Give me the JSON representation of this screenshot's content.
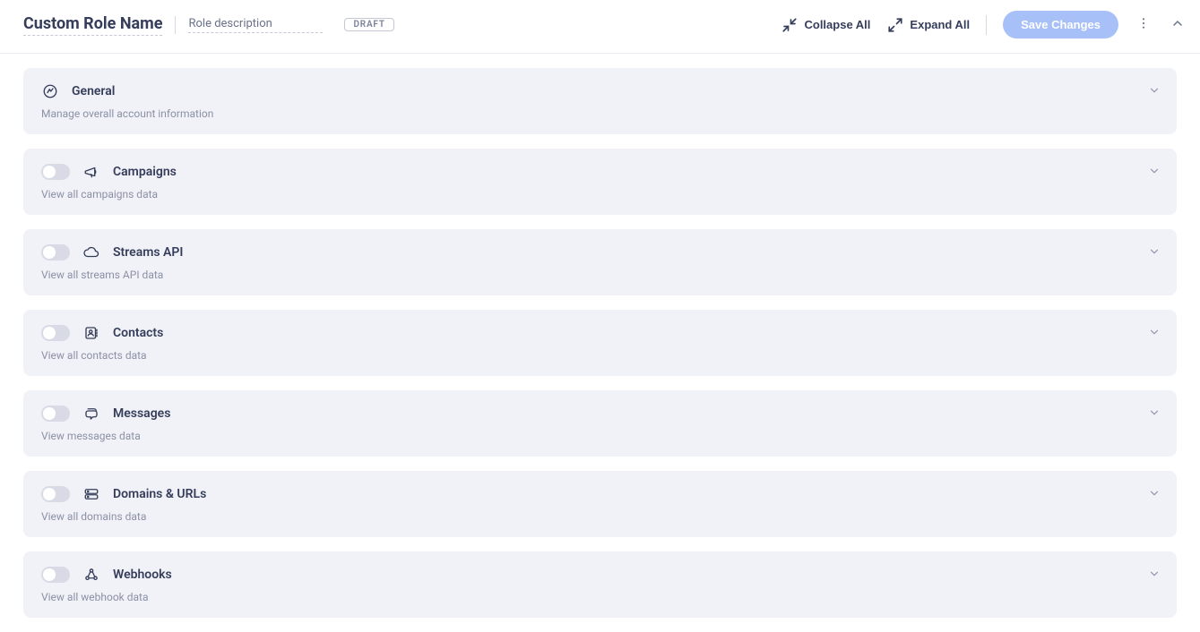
{
  "header": {
    "role_name": "Custom Role Name",
    "role_desc": "Role description",
    "draft_badge": "DRAFT",
    "collapse_all": "Collapse All",
    "expand_all": "Expand All",
    "save_changes": "Save Changes"
  },
  "sections": [
    {
      "title": "General",
      "desc": "Manage overall account information",
      "has_toggle": false
    },
    {
      "title": "Campaigns",
      "desc": "View all campaigns data",
      "has_toggle": true
    },
    {
      "title": "Streams API",
      "desc": "View all streams API data",
      "has_toggle": true
    },
    {
      "title": "Contacts",
      "desc": "View all contacts data",
      "has_toggle": true
    },
    {
      "title": "Messages",
      "desc": "View messages data",
      "has_toggle": true
    },
    {
      "title": "Domains & URLs",
      "desc": "View all domains data",
      "has_toggle": true
    },
    {
      "title": "Webhooks",
      "desc": "View all webhook data",
      "has_toggle": true
    }
  ]
}
